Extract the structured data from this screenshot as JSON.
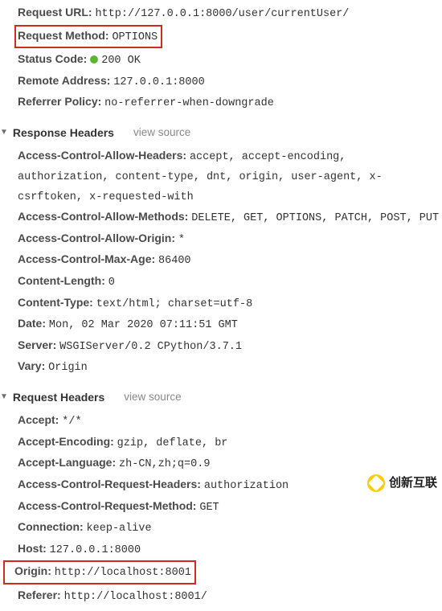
{
  "general": {
    "requestUrl": {
      "key": "Request URL:",
      "val": "http://127.0.0.1:8000/user/currentUser/"
    },
    "requestMethod": {
      "key": "Request Method:",
      "val": "OPTIONS"
    },
    "statusCode": {
      "key": "Status Code:",
      "val": "200 OK"
    },
    "remoteAddress": {
      "key": "Remote Address:",
      "val": "127.0.0.1:8000"
    },
    "referrerPolicy": {
      "key": "Referrer Policy:",
      "val": "no-referrer-when-downgrade"
    }
  },
  "responseHeaders": {
    "title": "Response Headers",
    "viewSource": "view source",
    "acAllowHeaders": {
      "key": "Access-Control-Allow-Headers:",
      "val": "accept, accept-encoding, authorization, content-type, dnt, origin, user-agent, x-csrftoken, x-requested-with"
    },
    "acAllowMethods": {
      "key": "Access-Control-Allow-Methods:",
      "val": "DELETE, GET, OPTIONS, PATCH, POST, PUT"
    },
    "acAllowOrigin": {
      "key": "Access-Control-Allow-Origin:",
      "val": "*"
    },
    "acMaxAge": {
      "key": "Access-Control-Max-Age:",
      "val": "86400"
    },
    "contentLength": {
      "key": "Content-Length:",
      "val": "0"
    },
    "contentType": {
      "key": "Content-Type:",
      "val": "text/html; charset=utf-8"
    },
    "date": {
      "key": "Date:",
      "val": "Mon, 02 Mar 2020 07:11:51 GMT"
    },
    "server": {
      "key": "Server:",
      "val": "WSGIServer/0.2 CPython/3.7.1"
    },
    "vary": {
      "key": "Vary:",
      "val": "Origin"
    }
  },
  "requestHeaders": {
    "title": "Request Headers",
    "viewSource": "view source",
    "accept": {
      "key": "Accept:",
      "val": "*/*"
    },
    "acceptEncoding": {
      "key": "Accept-Encoding:",
      "val": "gzip, deflate, br"
    },
    "acceptLanguage": {
      "key": "Accept-Language:",
      "val": "zh-CN,zh;q=0.9"
    },
    "acReqHeaders": {
      "key": "Access-Control-Request-Headers:",
      "val": "authorization"
    },
    "acReqMethod": {
      "key": "Access-Control-Request-Method:",
      "val": "GET"
    },
    "connection": {
      "key": "Connection:",
      "val": "keep-alive"
    },
    "host": {
      "key": "Host:",
      "val": "127.0.0.1:8000"
    },
    "origin": {
      "key": "Origin:",
      "val": "http://localhost:8001"
    },
    "referer": {
      "key": "Referer:",
      "val": "http://localhost:8001/"
    }
  },
  "watermark": "创新互联"
}
